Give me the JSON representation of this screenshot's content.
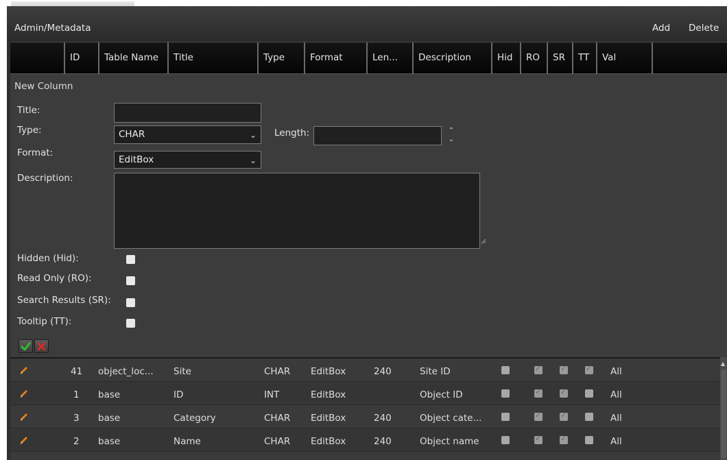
{
  "window": {
    "title": "Admin/Metadata",
    "add_label": "Add",
    "delete_label": "Delete"
  },
  "columns": [
    "ID",
    "Table Name",
    "Title",
    "Type",
    "Format",
    "Len...",
    "Description",
    "Hid",
    "RO",
    "SR",
    "TT",
    "Val"
  ],
  "form": {
    "heading": "New Column",
    "title_label": "Title:",
    "title_value": "",
    "type_label": "Type:",
    "type_value": "CHAR",
    "length_label": "Length:",
    "length_value": "",
    "format_label": "Format:",
    "format_value": "EditBox",
    "description_label": "Description:",
    "description_value": "",
    "hidden_label": "Hidden (Hid):",
    "readonly_label": "Read Only (RO):",
    "search_label": "Search Results (SR):",
    "tooltip_label": "Tooltip (TT):",
    "hidden_checked": false,
    "readonly_checked": false,
    "search_checked": false,
    "tooltip_checked": false
  },
  "rows": [
    {
      "id": "41",
      "table": "object_loc...",
      "title": "Site",
      "type": "CHAR",
      "format": "EditBox",
      "len": "240",
      "description": "Site ID",
      "hid": false,
      "ro": true,
      "sr": true,
      "tt": true,
      "val": "All"
    },
    {
      "id": "1",
      "table": "base",
      "title": "ID",
      "type": "INT",
      "format": "EditBox",
      "len": "",
      "description": "Object ID",
      "hid": false,
      "ro": true,
      "sr": true,
      "tt": false,
      "val": "All"
    },
    {
      "id": "3",
      "table": "base",
      "title": "Category",
      "type": "CHAR",
      "format": "EditBox",
      "len": "240",
      "description": "Object cate...",
      "hid": false,
      "ro": true,
      "sr": true,
      "tt": false,
      "val": "All"
    },
    {
      "id": "2",
      "table": "base",
      "title": "Name",
      "type": "CHAR",
      "format": "EditBox",
      "len": "240",
      "description": "Object name",
      "hid": false,
      "ro": true,
      "sr": true,
      "tt": false,
      "val": "All"
    }
  ],
  "icons": {
    "edit": "pencil-icon",
    "confirm": "checkmark-icon",
    "cancel": "x-icon",
    "dropdown": "chevron-down-icon",
    "spinner": "up-down-arrows-icon"
  },
  "colors": {
    "accent_green": "#2fbf2f",
    "accent_red": "#d62a2a",
    "pencil_orange": "#e87d1a"
  }
}
